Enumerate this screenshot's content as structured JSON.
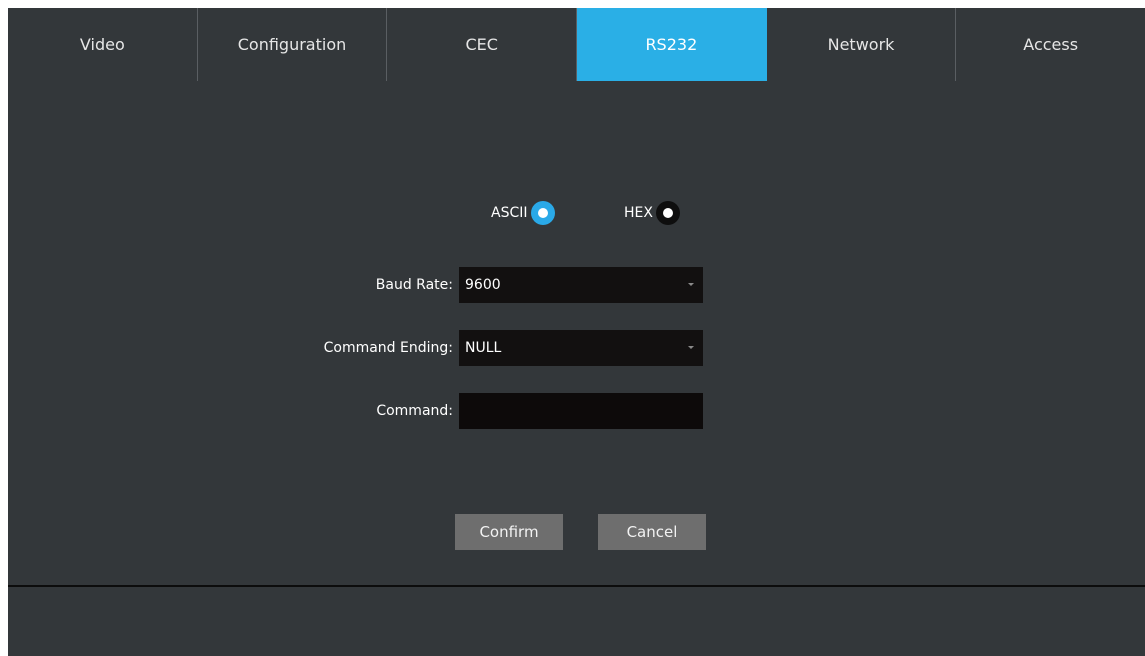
{
  "tabs": [
    {
      "label": "Video",
      "active": false
    },
    {
      "label": "Configuration",
      "active": false
    },
    {
      "label": "CEC",
      "active": false
    },
    {
      "label": "RS232",
      "active": true
    },
    {
      "label": "Network",
      "active": false
    },
    {
      "label": "Access",
      "active": false
    }
  ],
  "mode": {
    "ascii_label": "ASCII",
    "hex_label": "HEX",
    "selected": "ASCII"
  },
  "form": {
    "baud_rate_label": "Baud Rate:",
    "baud_rate_value": "9600",
    "command_ending_label": "Command Ending:",
    "command_ending_value": "NULL",
    "command_label": "Command:",
    "command_value": ""
  },
  "buttons": {
    "confirm": "Confirm",
    "cancel": "Cancel"
  },
  "colors": {
    "accent": "#2aafe6",
    "background": "#33373a",
    "button": "#6e6e6e"
  }
}
